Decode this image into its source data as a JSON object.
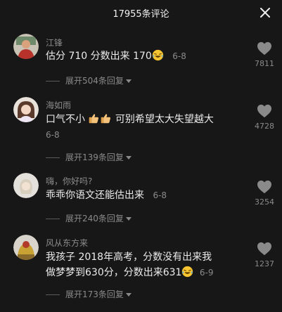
{
  "header": {
    "title": "17955条评论"
  },
  "colors": {
    "background": "#171717",
    "text": "#ececec",
    "muted": "#8a8a8a",
    "icon": "#8a8a8a"
  },
  "comments": [
    {
      "username": "江锋",
      "text": "估分 710 分数出来 170",
      "emoji": "laughing-tears-icon",
      "time": "6-8",
      "expand_label": "展开504条回复",
      "likes": "7811"
    },
    {
      "username": "海如雨",
      "text_before": "口气不小",
      "emoji": "thumbs-up-icon",
      "text_after": "可别希望太大失望越大",
      "time": "6-8",
      "expand_label": "展开139条回复",
      "likes": "4728"
    },
    {
      "username": "嗨，你好吗?",
      "text": "乖乖你语文还能估出来",
      "time": "6-8",
      "expand_label": "展开240条回复",
      "likes": "3254"
    },
    {
      "username": "风从东方来",
      "text_line1": "我孩子 2018年高考，分数没有出来我",
      "text_line2": "做梦梦到630分，分数出来631",
      "emoji": "laughing-tears-icon",
      "time": "6-9",
      "expand_label": "展开173条回复",
      "likes": "1237"
    }
  ]
}
